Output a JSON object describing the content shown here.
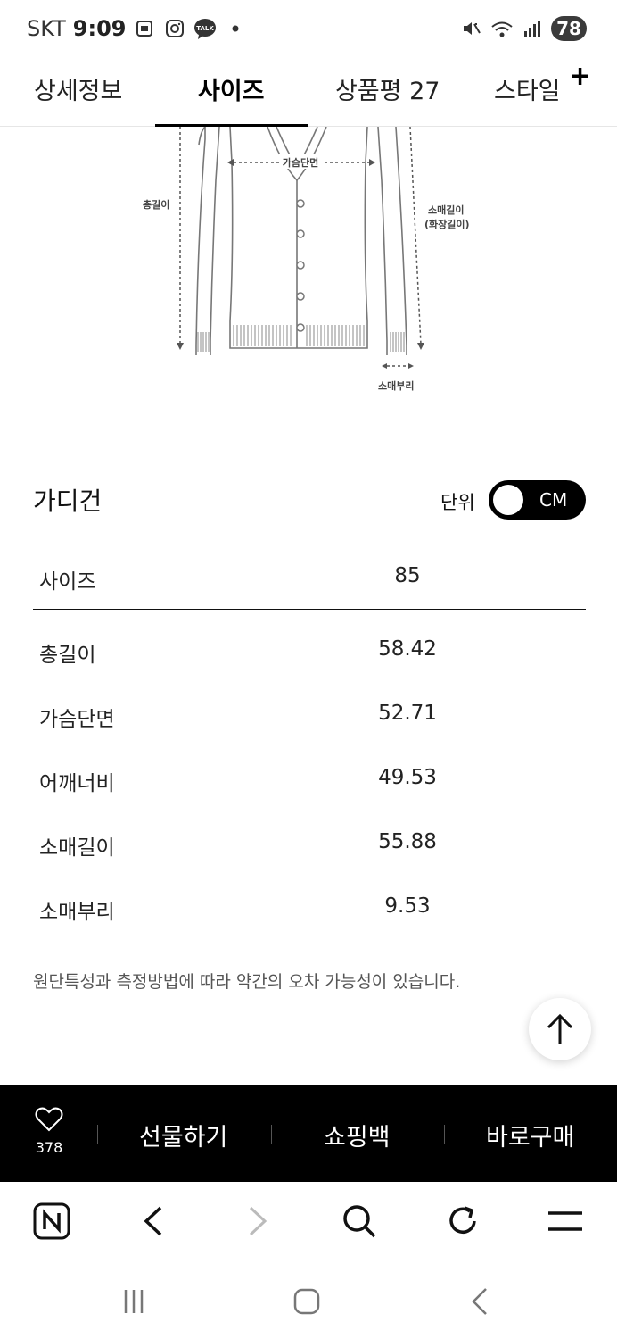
{
  "status": {
    "carrier": "SKT",
    "time": "9:09",
    "battery": "78",
    "talk_badge": "TALK"
  },
  "tabs": [
    {
      "label": "상세정보"
    },
    {
      "label": "사이즈"
    },
    {
      "label": "상품평 27"
    },
    {
      "label": "스타일"
    }
  ],
  "tab_plus": "+",
  "diagram": {
    "chest_label": "가슴단면",
    "length_label": "총길이",
    "sleeve_label_1": "소매길이",
    "sleeve_label_2": "(화장길이)",
    "cuff_label": "소매부리"
  },
  "size_section": {
    "title": "가디건",
    "unit_label": "단위",
    "unit_value": "CM",
    "header": {
      "label": "사이즈",
      "value": "85"
    },
    "rows": [
      {
        "label": "총길이",
        "value": "58.42"
      },
      {
        "label": "가슴단면",
        "value": "52.71"
      },
      {
        "label": "어깨너비",
        "value": "49.53"
      },
      {
        "label": "소매길이",
        "value": "55.88"
      },
      {
        "label": "소매부리",
        "value": "9.53"
      }
    ],
    "note": "원단특성과 측정방법에 따라 약간의 오차 가능성이 있습니다."
  },
  "action_bar": {
    "like_count": "378",
    "gift_label": "선물하기",
    "cart_label": "쇼핑백",
    "buy_label": "바로구매"
  }
}
